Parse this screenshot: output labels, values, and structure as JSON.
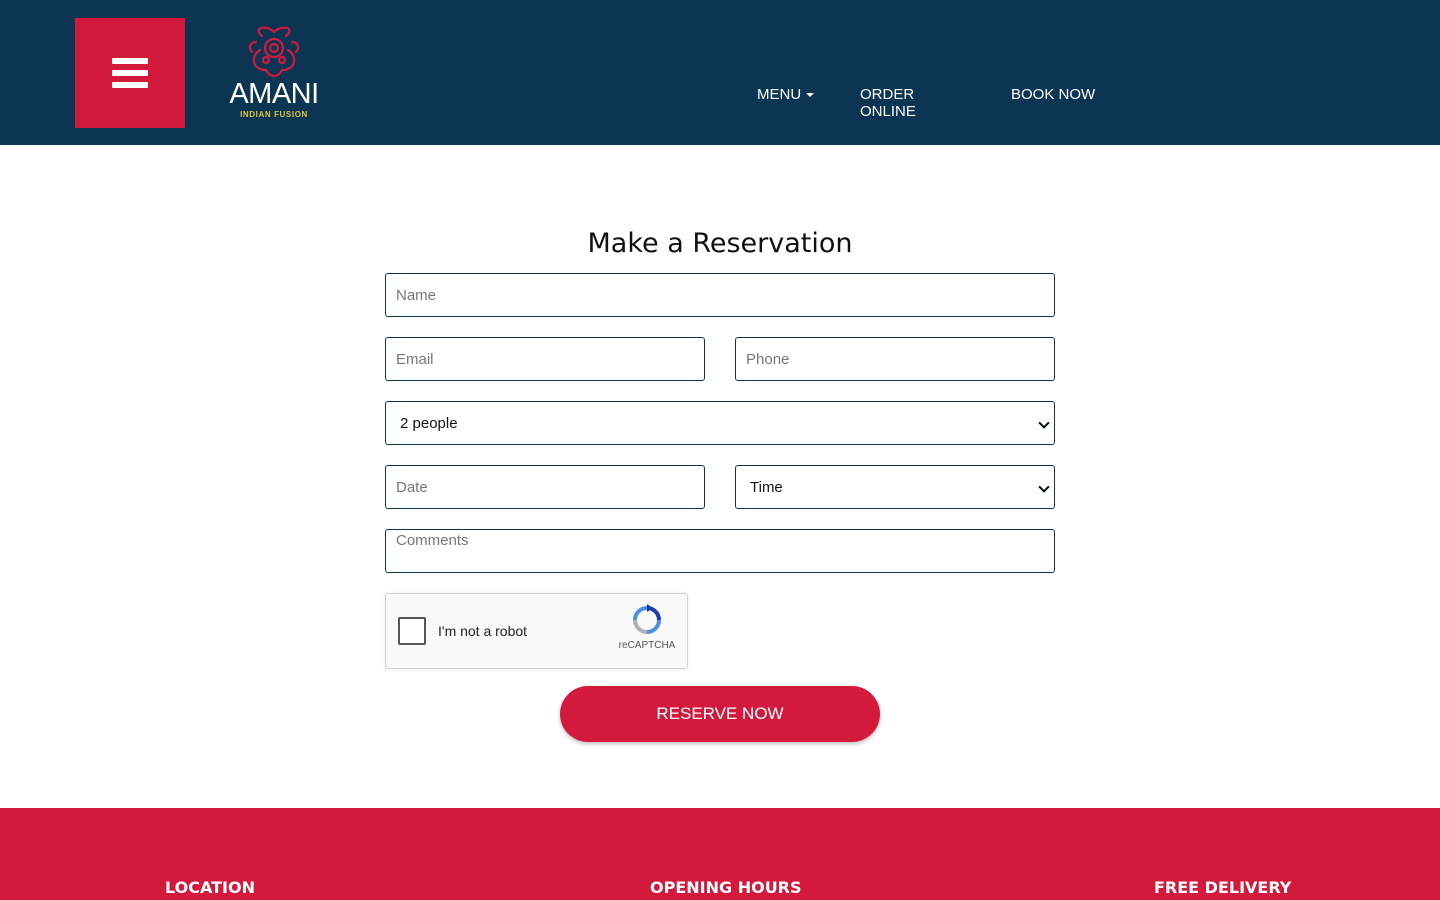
{
  "header": {
    "brand_name": "AMANI",
    "brand_tagline": "INDIAN FUSION",
    "nav": {
      "menu": "MENU",
      "order_online": "ORDER ONLINE",
      "book_now": "BOOK NOW"
    }
  },
  "reservation": {
    "title": "Make a Reservation",
    "name_placeholder": "Name",
    "email_placeholder": "Email",
    "phone_placeholder": "Phone",
    "party_size_selected": "2 people",
    "date_placeholder": "Date",
    "time_selected": "Time",
    "comments_placeholder": "Comments",
    "captcha_label": "I'm not a robot",
    "captcha_brand": "reCAPTCHA",
    "submit_label": "RESERVE NOW"
  },
  "footer": {
    "location_heading": "LOCATION",
    "hours_heading": "OPENING HOURS",
    "delivery_heading": "FREE DELIVERY"
  },
  "colors": {
    "header_bg": "#0c3553",
    "accent_red": "#d31a3c",
    "logo_gold": "#e2c53a"
  },
  "icons": {
    "hamburger": "menu-icon",
    "logo_emblem": "ornamental-emblem-icon",
    "dropdown": "caret-down-icon",
    "captcha": "recaptcha-icon"
  }
}
